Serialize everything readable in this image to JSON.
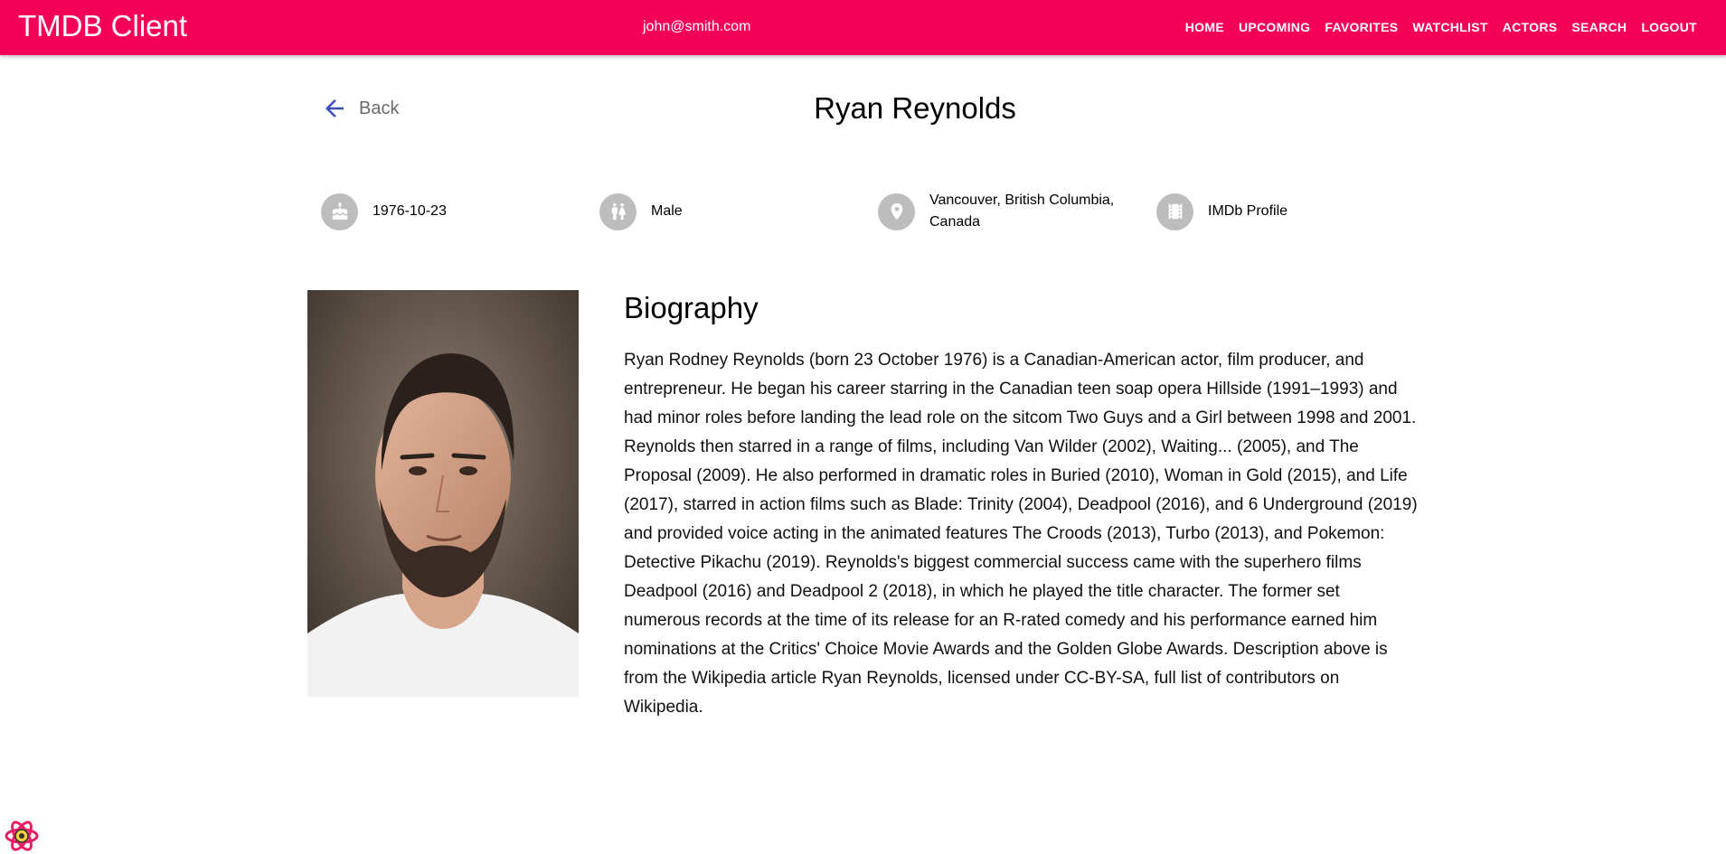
{
  "app": {
    "title": "TMDB Client",
    "user_email": "john@smith.com",
    "brand_color": "#f50057"
  },
  "nav": {
    "items": [
      {
        "label": "Home",
        "icon": ""
      },
      {
        "label": "Upcoming",
        "icon": ""
      },
      {
        "label": "Favorites",
        "icon": ""
      },
      {
        "label": "Watchlist",
        "icon": ""
      },
      {
        "label": "Actors",
        "icon": ""
      },
      {
        "label": "Search",
        "icon": ""
      },
      {
        "label": "Logout",
        "icon": ""
      }
    ]
  },
  "page": {
    "back_label": "Back",
    "back_icon": "arrow-left-icon",
    "title": "Ryan Reynolds"
  },
  "facts": [
    {
      "icon": "cake-icon",
      "text": "1976-10-23"
    },
    {
      "icon": "wc-icon",
      "text": "Male"
    },
    {
      "icon": "location-pin-icon",
      "text": "Vancouver, British Columbia, Canada"
    },
    {
      "icon": "film-icon",
      "text": "IMDb Profile"
    }
  ],
  "biography": {
    "heading": "Biography",
    "text": "Ryan Rodney Reynolds (born 23 October 1976) is a Canadian-American actor, film producer, and entrepreneur. He began his career starring in the Canadian teen soap opera Hillside (1991–1993) and had minor roles before landing the lead role on the sitcom Two Guys and a Girl between 1998 and 2001. Reynolds then starred in a range of films, including Van Wilder (2002), Waiting... (2005), and The Proposal (2009). He also performed in dramatic roles in Buried (2010), Woman in Gold (2015), and Life (2017), starred in action films such as Blade: Trinity (2004), Deadpool (2016), and 6 Underground (2019) and provided voice acting in the animated features The Croods (2013), Turbo (2013), and Pokemon: Detective Pikachu (2019). Reynolds's biggest commercial success came with the superhero films Deadpool (2016) and Deadpool 2 (2018), in which he played the title character. The former set numerous records at the time of its release for an R-rated comedy and his performance earned him nominations at the Critics' Choice Movie Awards and the Golden Globe Awards. Description above is from the Wikipedia article Ryan Reynolds, licensed under CC-BY-SA, full list of contributors on Wikipedia."
  },
  "devtools": {
    "icon": "react-devtools-icon"
  }
}
